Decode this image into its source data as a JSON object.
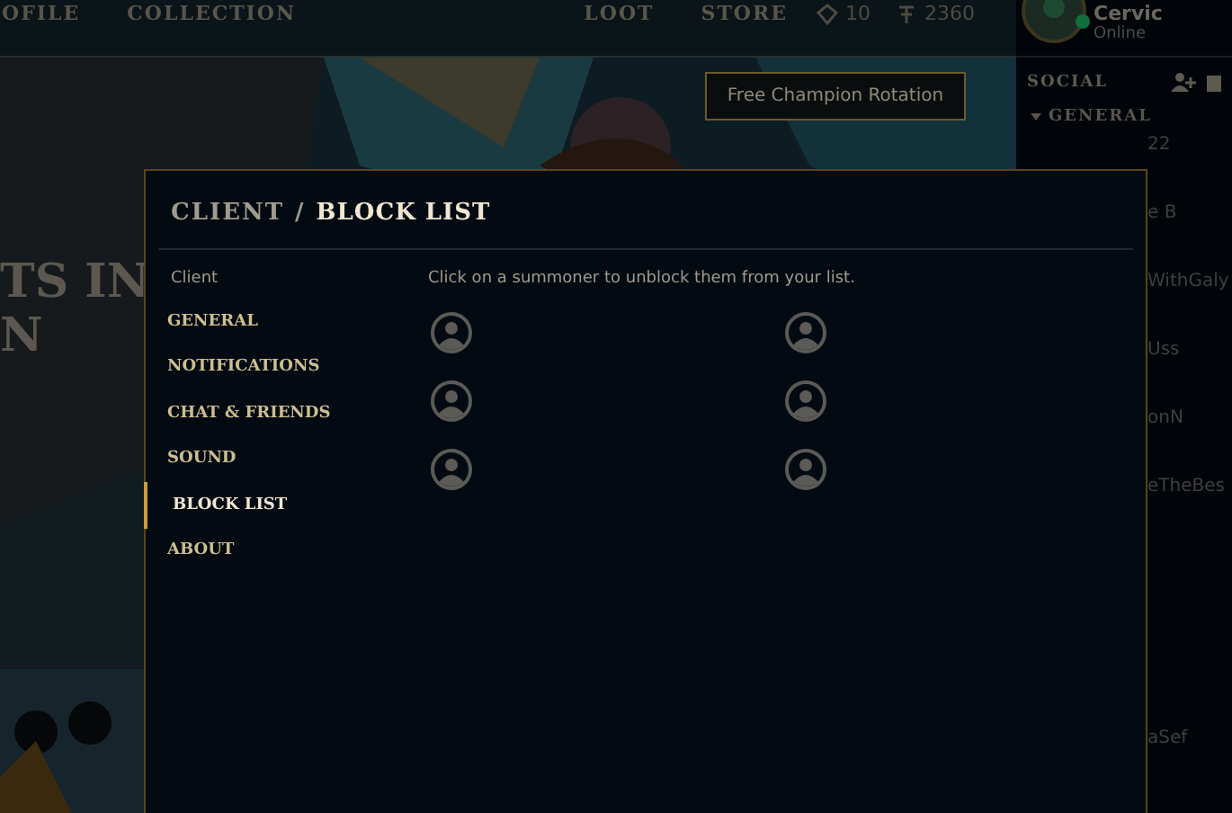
{
  "top_nav": {
    "items": [
      "OFILE",
      "COLLECTION",
      "LOOT",
      "STORE"
    ],
    "currencies": [
      {
        "kind": "essence",
        "amount": "10"
      },
      {
        "kind": "riot_points",
        "amount": "2360"
      }
    ]
  },
  "profile": {
    "name": "Cervic",
    "status": "Online"
  },
  "hero": {
    "banner_text": [
      "TS IN",
      "N"
    ],
    "button": "Free Champion Rotation"
  },
  "social": {
    "title": "SOCIAL",
    "group": "GENERAL",
    "friends": [
      "22",
      "e B",
      "WithGaly",
      "Uss",
      "onN",
      "eTheBes",
      "aSef"
    ]
  },
  "dialog": {
    "breadcrumb": "CLIENT",
    "separator": "/",
    "title": "BLOCK LIST",
    "sidebar": {
      "section": "Client",
      "items": [
        {
          "label": "GENERAL",
          "selected": false
        },
        {
          "label": "NOTIFICATIONS",
          "selected": false
        },
        {
          "label": "CHAT & FRIENDS",
          "selected": false
        },
        {
          "label": "SOUND",
          "selected": false
        },
        {
          "label": "BLOCK LIST",
          "selected": true
        },
        {
          "label": "ABOUT",
          "selected": false
        }
      ]
    },
    "hint": "Click on a summoner to unblock them from your list.",
    "blocked_summoners": [
      {
        "kind": "avatar"
      },
      {
        "kind": "avatar"
      },
      {
        "kind": "avatar"
      },
      {
        "kind": "avatar"
      },
      {
        "kind": "avatar"
      },
      {
        "kind": "avatar"
      }
    ]
  }
}
